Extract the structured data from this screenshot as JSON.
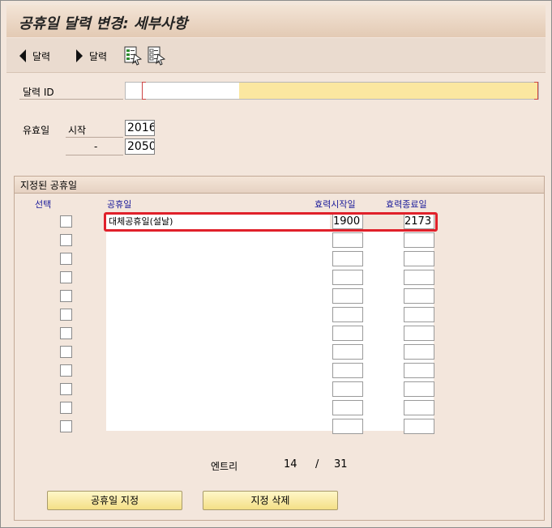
{
  "window": {
    "title": "공휴일 달력 변경: 세부사항"
  },
  "toolbar": {
    "prev_label": "달력",
    "next_label": "달력",
    "icon1": "select-all-icon",
    "icon2": "deselect-all-icon"
  },
  "form": {
    "calendar_id_label": "달력 ID",
    "calendar_id_value": "",
    "validity_label": "유효일",
    "start_label": "시작",
    "start_value": "2016",
    "end_label": "-",
    "end_value": "2050"
  },
  "group": {
    "title": "지정된 공휴일",
    "col_select": "선택",
    "col_holiday": "공휴일",
    "col_start": "효력시작일",
    "col_end": "효력종료일",
    "rows": [
      {
        "name": "대체공휴일(설날)",
        "start": "1900",
        "end": "2173"
      }
    ],
    "entries_label": "엔트리",
    "entries_current": "14",
    "entries_sep": "/",
    "entries_total": "31"
  },
  "buttons": {
    "assign": "공휴일 지정",
    "delete": "지정 삭제"
  },
  "colors": {
    "highlight": "#e0202a",
    "required_field": "#fbe7a0",
    "header_text": "#1a1a9a"
  }
}
